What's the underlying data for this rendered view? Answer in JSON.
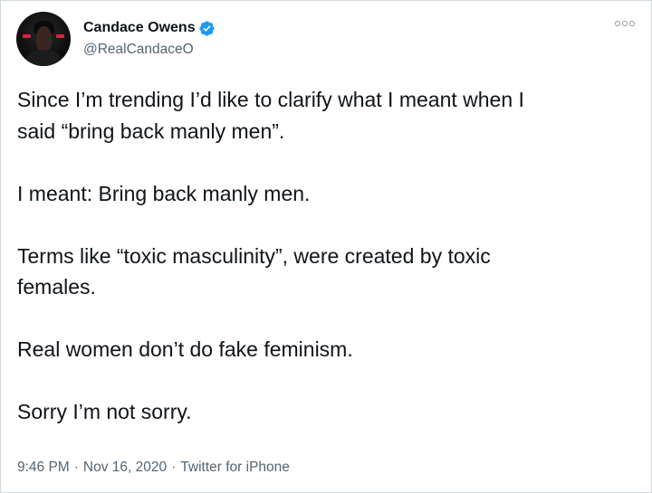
{
  "author": {
    "display_name": "Candace Owens",
    "handle": "@RealCandaceO",
    "verified": true
  },
  "tweet": {
    "paragraphs": [
      "Since I’m trending I’d like to clarify what I meant when I\nsaid “bring back manly men”.",
      "I meant: Bring back manly men.",
      "Terms like “toxic masculinity”, were created by toxic\nfemales.",
      "Real women don’t do fake feminism.",
      "Sorry I’m not sorry."
    ],
    "time": "9:46 PM",
    "date": "Nov 16, 2020",
    "source": "Twitter for iPhone",
    "separator": "·"
  },
  "colors": {
    "verified_badge": "#1d9bf0",
    "secondary_text": "#536471",
    "primary_text": "#0f1419"
  },
  "icons": {
    "verified": "verified-badge-icon",
    "more": "more-options-icon"
  }
}
